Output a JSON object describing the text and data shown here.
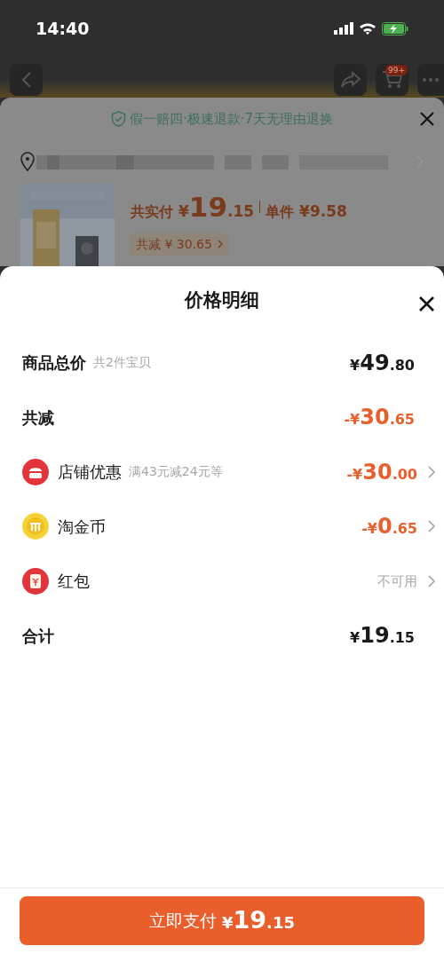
{
  "status_bar": {
    "time": "14:40"
  },
  "background": {
    "cart_badge": "99+",
    "guarantee": "假一赔四·极速退款·7天无理由退换",
    "product": {
      "paid_label": "共实付",
      "paid_prefix": "¥",
      "paid_main": "19",
      "paid_fraction": ".15",
      "unit_label": "单件",
      "unit_price": "¥9.58",
      "discount_tag": "共减 ¥ 30.65"
    }
  },
  "sheet": {
    "title": "价格明细",
    "rows": [
      {
        "kind": "summary",
        "label": "商品总价",
        "note": "共2件宝贝",
        "prefix": "¥",
        "main": "49",
        "fraction": ".80"
      },
      {
        "kind": "reduction",
        "label": "共减",
        "prefix": "-¥",
        "main": "30",
        "fraction": ".65"
      },
      {
        "kind": "discount",
        "label": "店铺优惠",
        "note": "满43元减24元等",
        "prefix": "-¥",
        "main": "30",
        "fraction": ".00"
      },
      {
        "kind": "discount",
        "label": "淘金币",
        "prefix": "-¥",
        "main": "0",
        "fraction": ".65"
      },
      {
        "kind": "unavailable",
        "label": "红包",
        "status": "不可用"
      },
      {
        "kind": "summary",
        "label": "合计",
        "prefix": "¥",
        "main": "19",
        "fraction": ".15"
      }
    ]
  },
  "pay_button": {
    "label": "立即支付",
    "prefix": "¥",
    "main": "19",
    "fraction": ".15"
  }
}
